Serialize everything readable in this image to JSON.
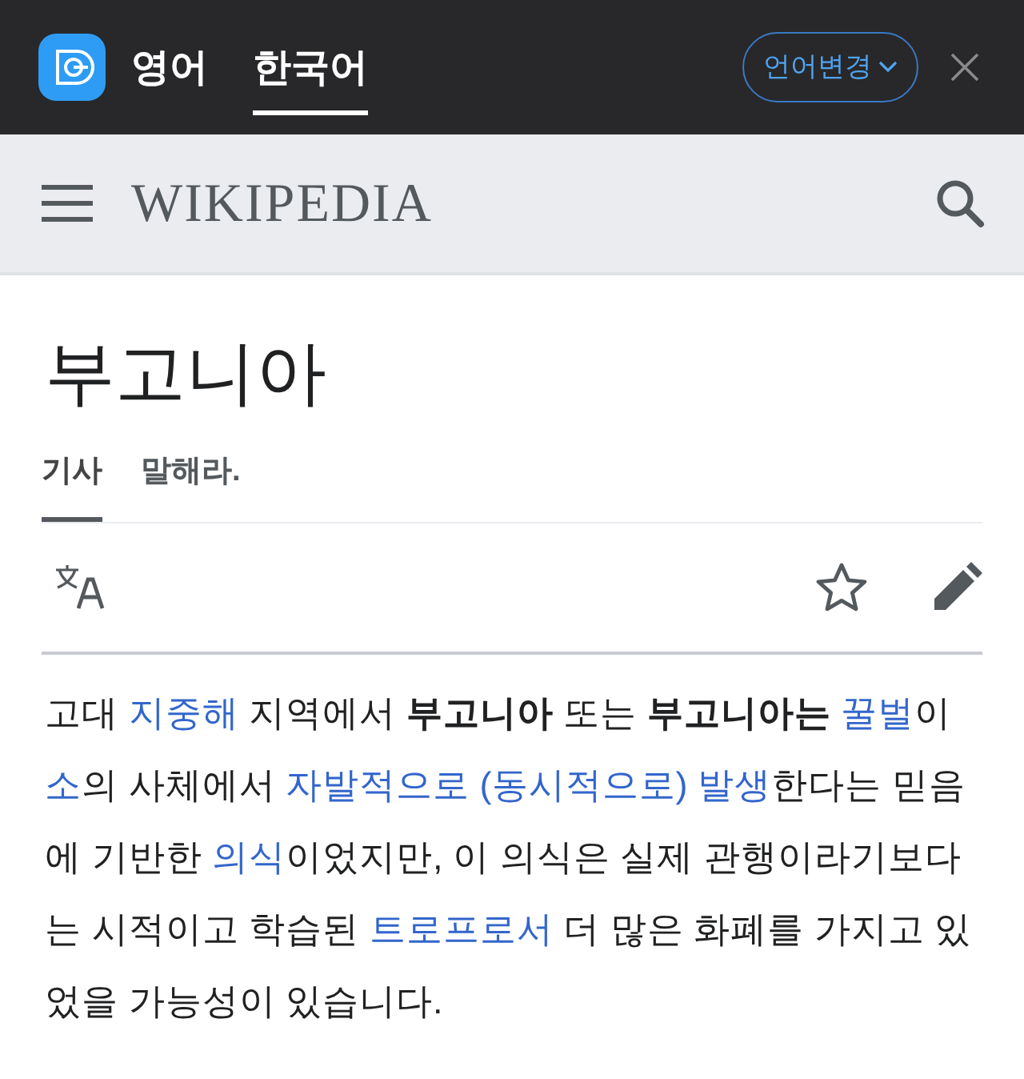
{
  "translate_bar": {
    "languages": [
      {
        "label": "영어",
        "selected": false
      },
      {
        "label": "한국어",
        "selected": true
      }
    ],
    "change_button": "언어변경"
  },
  "header": {
    "logo": "WIKIPEDIA"
  },
  "article": {
    "title": "부고니아",
    "tabs": [
      {
        "label": "기사",
        "selected": true
      },
      {
        "label": "말해라.",
        "selected": false
      }
    ],
    "paragraph": [
      {
        "kind": "plain",
        "text": "고대 "
      },
      {
        "kind": "link",
        "text": "지중해"
      },
      {
        "kind": "plain",
        "text": " 지역에서 "
      },
      {
        "kind": "bold",
        "text": "부고니아"
      },
      {
        "kind": "plain",
        "text": " 또는 "
      },
      {
        "kind": "bold",
        "text": "부고니아는 "
      },
      {
        "kind": "link",
        "text": "꿀벌"
      },
      {
        "kind": "plain",
        "text": "이 "
      },
      {
        "kind": "link",
        "text": "소"
      },
      {
        "kind": "plain",
        "text": "의 사체에서 "
      },
      {
        "kind": "link",
        "text": "자발적으로 (동시적으로) 발생"
      },
      {
        "kind": "plain",
        "text": "한다는 믿음에 기반한 "
      },
      {
        "kind": "link",
        "text": "의식"
      },
      {
        "kind": "plain",
        "text": "이었지만, 이 의식은 실제 관행이라기보다는 시적이고 학습된 "
      },
      {
        "kind": "link",
        "text": "트로프로서"
      },
      {
        "kind": "plain",
        "text": " 더 많은 화폐를 가지고 있었을 가능성이 있습니다."
      }
    ]
  }
}
